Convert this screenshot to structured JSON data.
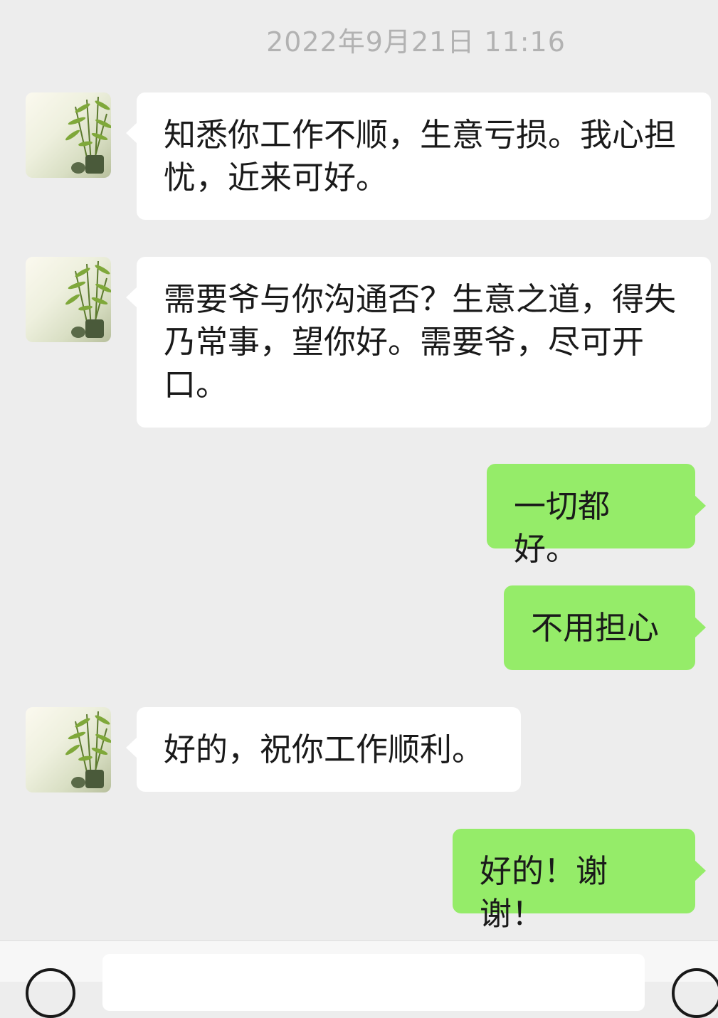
{
  "chat": {
    "timestamp": "2022年9月21日 11:16",
    "messages": [
      {
        "direction": "in",
        "text": "知悉你工作不顺，生意亏损。我心担忧，近来可好。"
      },
      {
        "direction": "in",
        "text": "需要爷与你沟通否？生意之道，得失乃常事，望你好。需要爷，尽可开口。"
      },
      {
        "direction": "out",
        "text": "一切都好。"
      },
      {
        "direction": "out",
        "text": "不用担心"
      },
      {
        "direction": "in",
        "text": "好的，祝你工作顺利。"
      },
      {
        "direction": "out",
        "text": "好的！谢谢！"
      }
    ]
  },
  "colors": {
    "background": "#ededed",
    "incoming_bubble": "#ffffff",
    "outgoing_bubble": "#95ec69",
    "timestamp_text": "#b2b2b2"
  },
  "icons": {
    "contact_avatar": "bamboo-plant-avatar",
    "voice": "voice-mode-icon",
    "emoji": "emoji-icon"
  }
}
